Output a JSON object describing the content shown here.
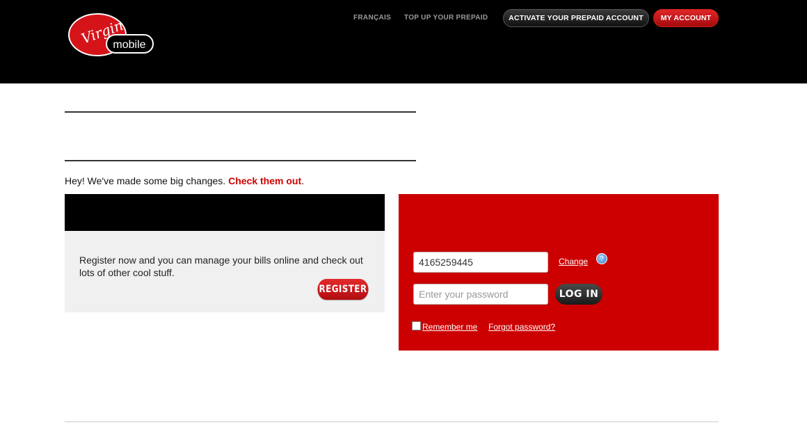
{
  "header": {
    "logo": {
      "top": "Virgin",
      "bottom": "mobile"
    },
    "nav": [
      {
        "label": "FRANÇAIS"
      },
      {
        "label": "TOP UP YOUR PREPAID"
      }
    ],
    "activate_label": "ACTIVATE YOUR PREPAID ACCOUNT",
    "my_account_label": "MY ACCOUNT"
  },
  "notice": {
    "text": "Hey! We've made some big changes. ",
    "link": "Check them out",
    "end": "."
  },
  "register": {
    "text": "Register now and you can manage your bills online and check out lots of other cool stuff.",
    "button": "REGISTER"
  },
  "login": {
    "phone_value": "4165259445",
    "change_label": "Change",
    "help_icon": "?",
    "password_placeholder": "Enter your password",
    "login_button": "LOG IN",
    "remember_label": "Remember me",
    "forgot_label": "Forgot password?"
  },
  "colors": {
    "brand_red": "#cc0000",
    "header_bg": "#000000"
  }
}
